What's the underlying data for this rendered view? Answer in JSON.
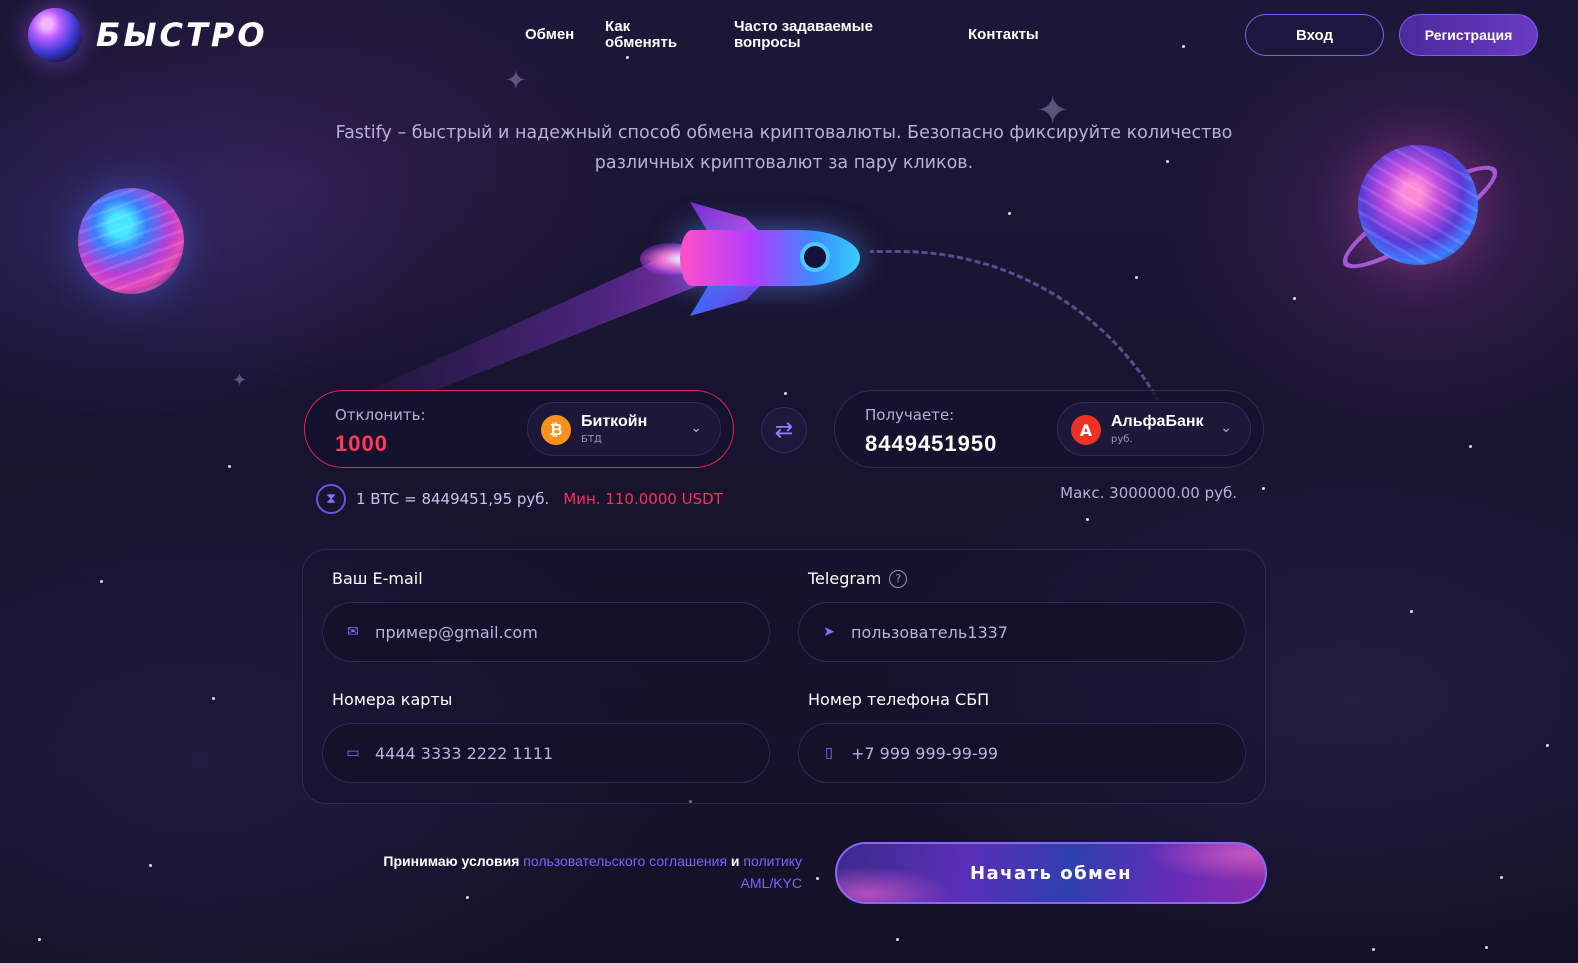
{
  "brand": {
    "name": "БЫСТРО"
  },
  "nav": {
    "items": [
      {
        "label": "Обмен"
      },
      {
        "label": "Как обменять"
      },
      {
        "label": "Часто задаваемые вопросы"
      },
      {
        "label": "Контакты"
      }
    ],
    "login_label": "Вход",
    "register_label": "Регистрация"
  },
  "tagline": "Fastify – быстрый и надежный способ обмена криптовалюты. Безопасно фиксируйте количество различных криптовалют за пару кликов.",
  "exchange": {
    "send": {
      "label": "Отклонить:",
      "amount": "1000",
      "currency_name": "Биткойн",
      "currency_code": "БТД",
      "currency_icon": "bitcoin-icon"
    },
    "receive": {
      "label": "Получаете:",
      "amount": "8449451950",
      "currency_name": "АльфаБанк",
      "currency_code": "руб.",
      "currency_icon": "alfabank-icon"
    },
    "rate": "1 BTC = 8449451,95 руб.",
    "min": "Мин. 110.0000 USDT",
    "max": "Макс. 3000000.00 руб."
  },
  "form": {
    "email_label": "Ваш E-mail",
    "email_placeholder": "пример@gmail.com",
    "telegram_label": "Telegram",
    "telegram_placeholder": "пользователь1337",
    "card_label": "Номера карты",
    "card_placeholder": "4444 3333 2222 1111",
    "phone_label": "Номер телефона СБП",
    "phone_placeholder": "+7 999 999-99-99"
  },
  "agreement": {
    "prefix": "Принимаю условия",
    "link1": "пользовательского соглашения",
    "conj": "и",
    "link2": "политику AML/KYC"
  },
  "submit_label": "Начать обмен",
  "colors": {
    "accent": "#7e5cf0",
    "error": "#ff2e57",
    "bitcoin": "#f7931a",
    "alfabank": "#ef3124"
  }
}
